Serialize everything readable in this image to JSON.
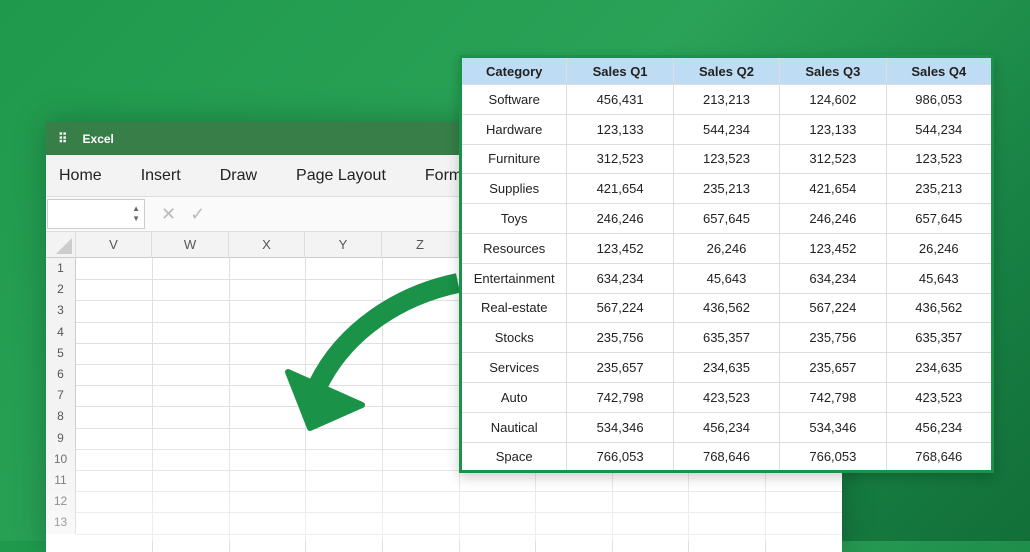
{
  "app": {
    "title": "Excel",
    "icon": "app-grid-icon"
  },
  "ribbon": [
    "Home",
    "Insert",
    "Draw",
    "Page Layout",
    "Formula"
  ],
  "columns": [
    "V",
    "W",
    "X",
    "Y",
    "Z"
  ],
  "rows": [
    "1",
    "2",
    "3",
    "4",
    "5",
    "6",
    "7",
    "8",
    "9",
    "10",
    "11",
    "12",
    "13"
  ],
  "table": {
    "headers": [
      "Category",
      "Sales Q1",
      "Sales Q2",
      "Sales Q3",
      "Sales Q4"
    ],
    "rows": [
      [
        "Software",
        "456,431",
        "213,213",
        "124,602",
        "986,053"
      ],
      [
        "Hardware",
        "123,133",
        "544,234",
        "123,133",
        "544,234"
      ],
      [
        "Furniture",
        "312,523",
        "123,523",
        "312,523",
        "123,523"
      ],
      [
        "Supplies",
        "421,654",
        "235,213",
        "421,654",
        "235,213"
      ],
      [
        "Toys",
        "246,246",
        "657,645",
        "246,246",
        "657,645"
      ],
      [
        "Resources",
        "123,452",
        "26,246",
        "123,452",
        "26,246"
      ],
      [
        "Entertainment",
        "634,234",
        "45,643",
        "634,234",
        "45,643"
      ],
      [
        "Real-estate",
        "567,224",
        "436,562",
        "567,224",
        "436,562"
      ],
      [
        "Stocks",
        "235,756",
        "635,357",
        "235,756",
        "635,357"
      ],
      [
        "Services",
        "235,657",
        "234,635",
        "235,657",
        "234,635"
      ],
      [
        "Auto",
        "742,798",
        "423,523",
        "742,798",
        "423,523"
      ],
      [
        "Nautical",
        "534,346",
        "456,234",
        "534,346",
        "456,234"
      ],
      [
        "Space",
        "766,053",
        "768,646",
        "766,053",
        "768,646"
      ]
    ]
  },
  "colors": {
    "accent": "#1a9248",
    "header_bg": "#bedcf3",
    "titlebar": "#377e48"
  }
}
